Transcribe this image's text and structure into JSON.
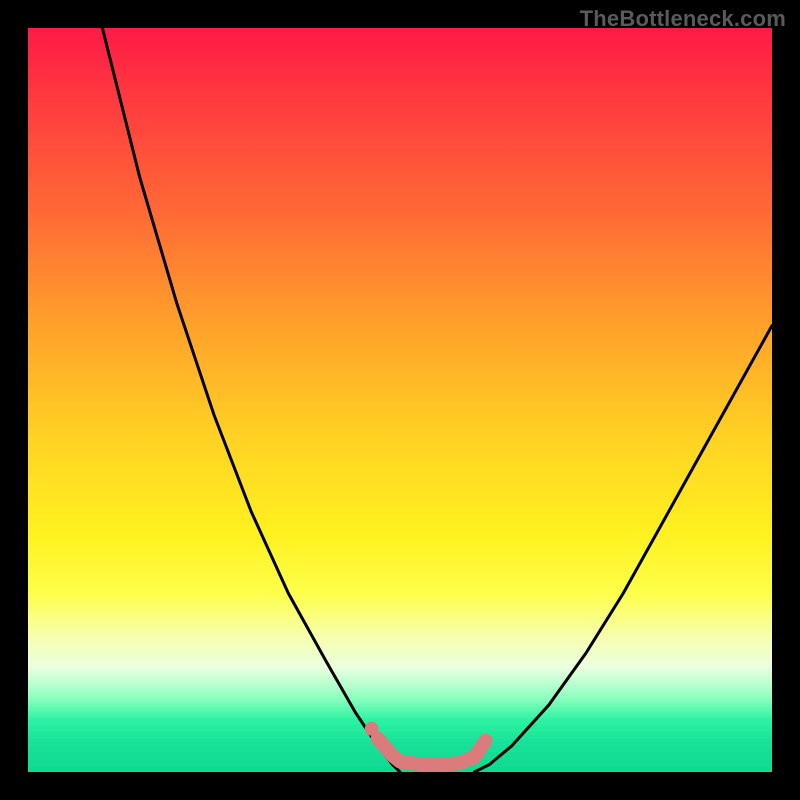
{
  "watermark": "TheBottleneck.com",
  "chart_data": {
    "type": "line",
    "title": "",
    "xlabel": "",
    "ylabel": "",
    "xlim": [
      0,
      100
    ],
    "ylim": [
      0,
      100
    ],
    "series": [
      {
        "name": "left-curve",
        "x": [
          10,
          15,
          20,
          25,
          30,
          35,
          40,
          44,
          47,
          49,
          50
        ],
        "values": [
          100,
          80,
          63,
          48,
          35,
          24,
          15,
          8,
          3.5,
          1,
          0
        ]
      },
      {
        "name": "right-curve",
        "x": [
          60,
          62,
          65,
          70,
          75,
          80,
          85,
          90,
          95,
          100
        ],
        "values": [
          0,
          1,
          3.5,
          9,
          16,
          24,
          33,
          42,
          51,
          60
        ]
      },
      {
        "name": "bottom-highlight",
        "x": [
          47,
          49,
          50,
          53,
          56,
          58,
          60,
          61.5
        ],
        "values": [
          4.5,
          2.2,
          1.4,
          1,
          1,
          1.2,
          2,
          4.2
        ]
      }
    ],
    "gradient_bands": [
      {
        "stop": 0,
        "color": "#ff1a46"
      },
      {
        "stop": 10,
        "color": "#ff3b3f"
      },
      {
        "stop": 25,
        "color": "#ff6a35"
      },
      {
        "stop": 40,
        "color": "#ffa12a"
      },
      {
        "stop": 55,
        "color": "#ffd223"
      },
      {
        "stop": 68,
        "color": "#fff120"
      },
      {
        "stop": 76,
        "color": "#fdff4a"
      },
      {
        "stop": 82,
        "color": "#f6ffb0"
      },
      {
        "stop": 86,
        "color": "#e9ffe0"
      },
      {
        "stop": 90,
        "color": "#8effc0"
      },
      {
        "stop": 93,
        "color": "#2bf3a2"
      },
      {
        "stop": 96,
        "color": "#18e29a"
      },
      {
        "stop": 100,
        "color": "#0fd98f"
      }
    ],
    "highlight_color": "#dc7b7b",
    "curve_color": "#000000"
  }
}
